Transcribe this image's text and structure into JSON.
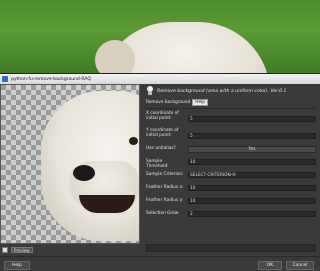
{
  "window": {
    "title": "python-fu-remove-background-RAQ"
  },
  "plugin": {
    "heading": "Remove background (area with a uniform color). Ver.0.1"
  },
  "fields": {
    "remove_background_label": "Remove background",
    "help_label": "Help",
    "x_label": "X coordinate of initial point:",
    "x_value": "5",
    "y_label": "Y coordinate of initial point:",
    "y_value": "5",
    "antialias_label": "Use antialias?",
    "antialias_value": "Yes",
    "threshold_label": "Sample Threshold:",
    "threshold_value": "10",
    "criterion_label": "Sample Criterion:",
    "criterion_value": "SELECT-CRITERION-H",
    "feather_x_label": "Feather Radius x:",
    "feather_x_value": "10",
    "feather_y_label": "Feather Radius y:",
    "feather_y_value": "10",
    "grow_label": "Selection Grow:",
    "grow_value": "2"
  },
  "preview": {
    "button_label": "Preview"
  },
  "footer": {
    "help": "Help",
    "ok": "OK",
    "cancel": "Cancel"
  },
  "colors": {
    "accent": "#2d6fb8",
    "panel": "#3a3a3a",
    "field": "#2a2a2a"
  }
}
